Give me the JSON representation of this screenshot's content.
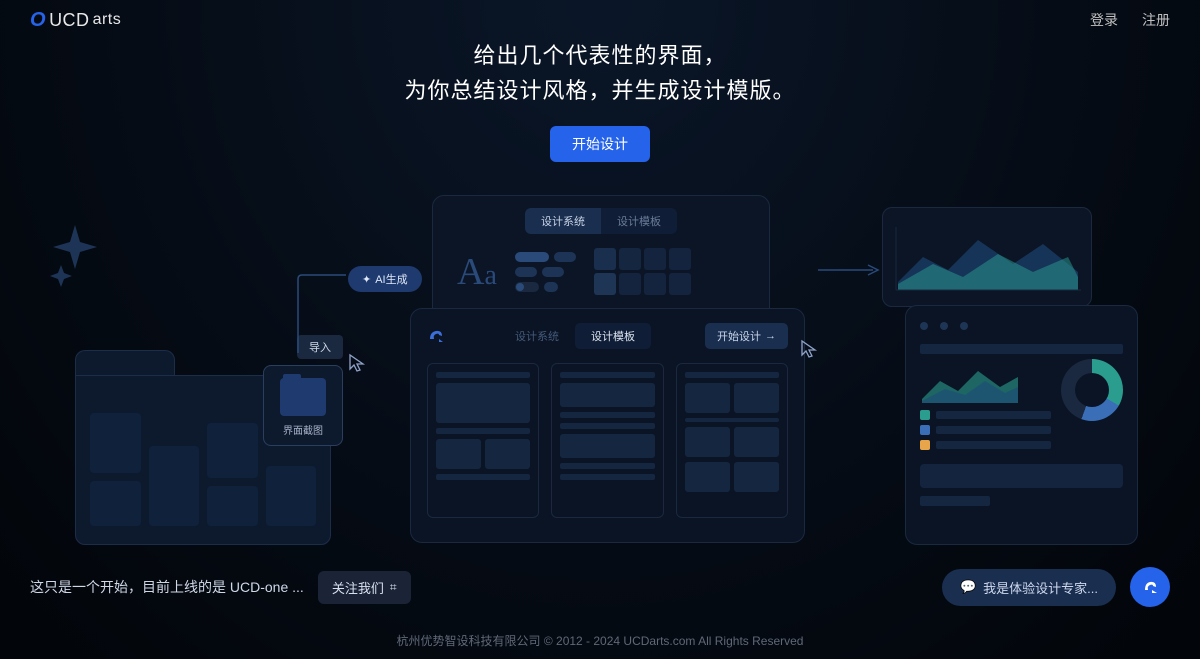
{
  "brand": {
    "name": "UCDarts"
  },
  "nav": {
    "login": "登录",
    "register": "注册"
  },
  "hero": {
    "line1": "给出几个代表性的界面，",
    "line2": "为你总结设计风格，并生成设计模版。",
    "cta": "开始设计"
  },
  "import": {
    "tag": "导入",
    "card_label": "界面截图"
  },
  "ai_tag": "AI生成",
  "system_panel": {
    "tab1": "设计系统",
    "tab2": "设计模板",
    "aa": "Aa"
  },
  "templates_panel": {
    "tab1": "设计系统",
    "tab2": "设计模板",
    "start": "开始设计"
  },
  "footer": {
    "tagline": "这只是一个开始，目前上线的是 UCD-one ...",
    "follow": "关注我们",
    "chat": "我是体验设计专家...",
    "copyright": "杭州优势智设科技有限公司 © 2012 - 2024 UCDarts.com All Rights Reserved"
  }
}
